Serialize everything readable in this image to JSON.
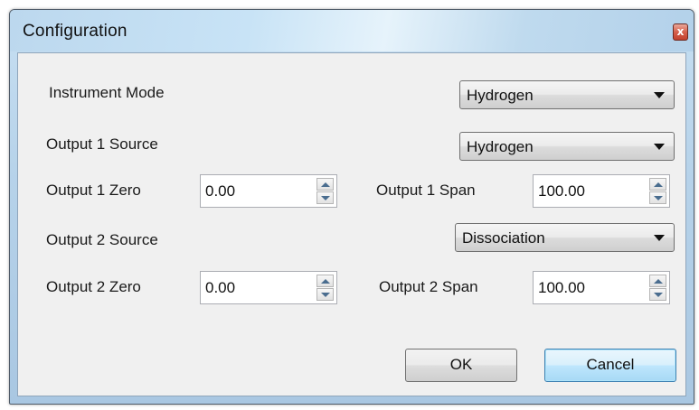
{
  "window": {
    "title": "Configuration",
    "close_glyph": "x"
  },
  "form": {
    "instrument_mode": {
      "label": "Instrument Mode",
      "value": "Hydrogen"
    },
    "output1_source": {
      "label": "Output 1 Source",
      "value": "Hydrogen"
    },
    "output1_zero": {
      "label": "Output 1 Zero",
      "value": "0.00"
    },
    "output1_span": {
      "label": "Output 1 Span",
      "value": "100.00"
    },
    "output2_source": {
      "label": "Output 2 Source",
      "value": "Dissociation"
    },
    "output2_zero": {
      "label": "Output 2 Zero",
      "value": "0.00"
    },
    "output2_span": {
      "label": "Output 2 Span",
      "value": "100.00"
    }
  },
  "buttons": {
    "ok": "OK",
    "cancel": "Cancel"
  },
  "icons": {
    "close": "close-icon",
    "dropdown": "chevron-down-icon",
    "spin_up": "spin-up-icon",
    "spin_down": "spin-down-icon"
  },
  "colors": {
    "titlebar": "#c8e3f6",
    "close_button": "#d6604c",
    "client_background": "#f0f0f0",
    "default_button_border": "#3c7fb1"
  }
}
